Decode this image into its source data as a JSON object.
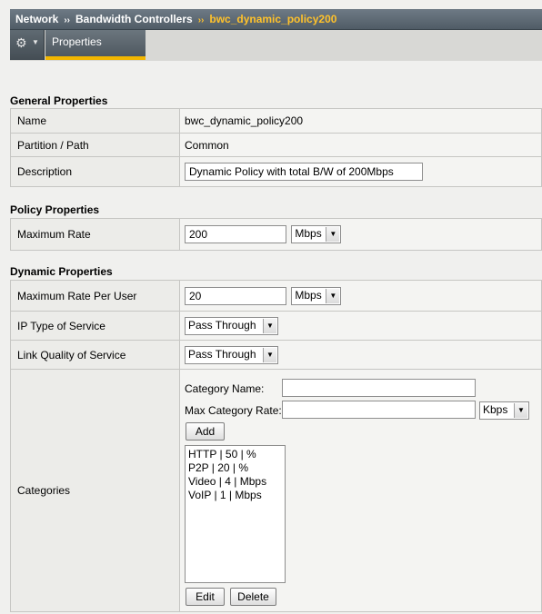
{
  "breadcrumb": {
    "items": [
      "Network",
      "Bandwidth Controllers"
    ],
    "current": "bwc_dynamic_policy200",
    "separator": "››"
  },
  "tabs": {
    "gear_icon": "gear-icon",
    "properties_label": "Properties"
  },
  "general": {
    "title": "General Properties",
    "name_label": "Name",
    "name_value": "bwc_dynamic_policy200",
    "partition_label": "Partition / Path",
    "partition_value": "Common",
    "description_label": "Description",
    "description_value": "Dynamic Policy with total B/W of 200Mbps"
  },
  "policy": {
    "title": "Policy Properties",
    "max_rate_label": "Maximum Rate",
    "max_rate_value": "200",
    "max_rate_unit": "Mbps"
  },
  "dynamic": {
    "title": "Dynamic Properties",
    "per_user_label": "Maximum Rate Per User",
    "per_user_value": "20",
    "per_user_unit": "Mbps",
    "ip_tos_label": "IP Type of Service",
    "ip_tos_value": "Pass Through",
    "link_qos_label": "Link Quality of Service",
    "link_qos_value": "Pass Through"
  },
  "categories": {
    "label": "Categories",
    "name_label": "Category Name:",
    "name_value": "",
    "max_rate_label": "Max Category Rate:",
    "max_rate_value": "",
    "max_rate_unit": "Kbps",
    "add_label": "Add",
    "edit_label": "Edit",
    "delete_label": "Delete",
    "items": [
      "HTTP | 50 | %",
      "P2P | 20 | %",
      "Video | 4 | Mbps",
      "VoIP | 1 | Mbps"
    ]
  }
}
